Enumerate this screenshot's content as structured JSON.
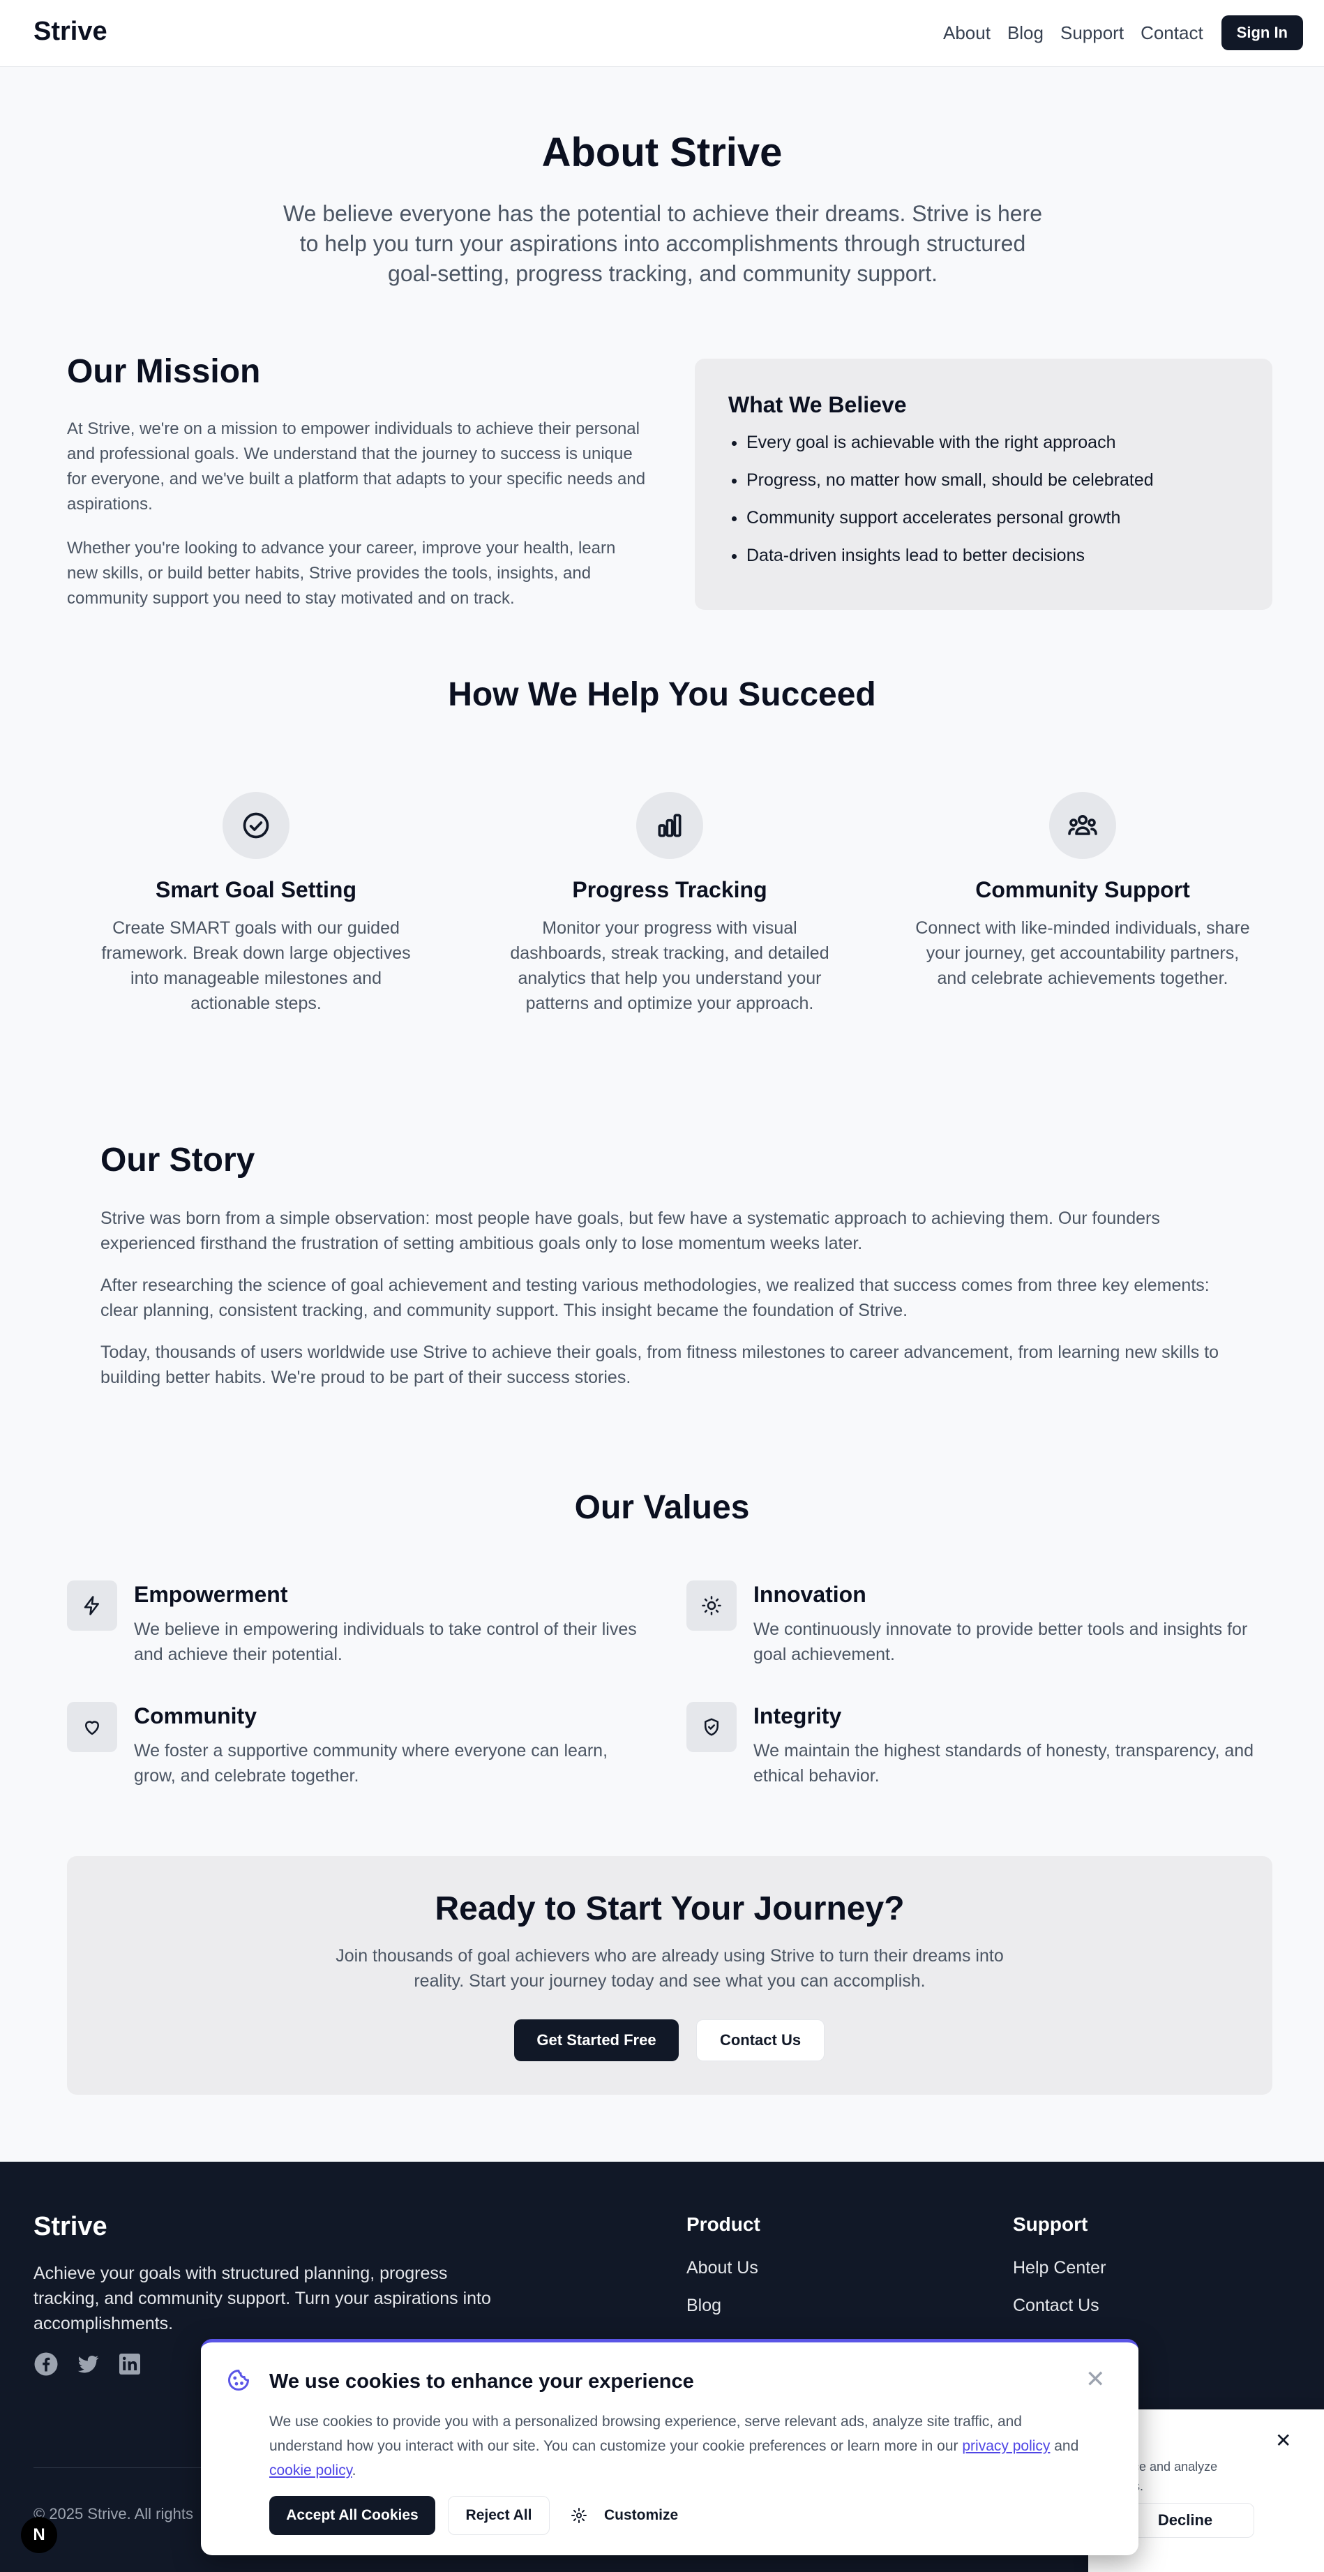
{
  "header": {
    "brand": "Strive",
    "nav": [
      "About",
      "Blog",
      "Support",
      "Contact"
    ],
    "sign_in": "Sign In"
  },
  "hero": {
    "title": "About Strive",
    "text": "We believe everyone has the potential to achieve their dreams. Strive is here to help you turn your aspirations into accomplishments through structured goal-setting, progress tracking, and community support."
  },
  "mission": {
    "title": "Our Mission",
    "p1": "At Strive, we're on a mission to empower individuals to achieve their personal and professional goals. We understand that the journey to success is unique for everyone, and we've built a platform that adapts to your specific needs and aspirations.",
    "p2": "Whether you're looking to advance your career, improve your health, learn new skills, or build better habits, Strive provides the tools, insights, and community support you need to stay motivated and on track."
  },
  "believe": {
    "title": "What We Believe",
    "items": [
      "Every goal is achievable with the right approach",
      "Progress, no matter how small, should be celebrated",
      "Community support accelerates personal growth",
      "Data-driven insights lead to better decisions"
    ]
  },
  "help": {
    "title": "How We Help You Succeed",
    "features": [
      {
        "icon": "check-circle-icon",
        "title": "Smart Goal Setting",
        "desc": "Create SMART goals with our guided framework. Break down large objectives into manageable milestones and actionable steps."
      },
      {
        "icon": "bar-chart-icon",
        "title": "Progress Tracking",
        "desc": "Monitor your progress with visual dashboards, streak tracking, and detailed analytics that help you understand your patterns and optimize your approach."
      },
      {
        "icon": "users-icon",
        "title": "Community Support",
        "desc": "Connect with like-minded individuals, share your journey, get accountability partners, and celebrate achievements together."
      }
    ]
  },
  "story": {
    "title": "Our Story",
    "p1": "Strive was born from a simple observation: most people have goals, but few have a systematic approach to achieving them. Our founders experienced firsthand the frustration of setting ambitious goals only to lose momentum weeks later.",
    "p2": "After researching the science of goal achievement and testing various methodologies, we realized that success comes from three key elements: clear planning, consistent tracking, and community support. This insight became the foundation of Strive.",
    "p3": "Today, thousands of users worldwide use Strive to achieve their goals, from fitness milestones to career advancement, from learning new skills to building better habits. We're proud to be part of their success stories."
  },
  "values": {
    "title": "Our Values",
    "items": [
      {
        "icon": "lightning-icon",
        "title": "Empowerment",
        "desc": "We believe in empowering individuals to take control of their lives and achieve their potential."
      },
      {
        "icon": "lightbulb-icon",
        "title": "Innovation",
        "desc": "We continuously innovate to provide better tools and insights for goal achievement."
      },
      {
        "icon": "heart-icon",
        "title": "Community",
        "desc": "We foster a supportive community where everyone can learn, grow, and celebrate together."
      },
      {
        "icon": "shield-check-icon",
        "title": "Integrity",
        "desc": "We maintain the highest standards of honesty, transparency, and ethical behavior."
      }
    ]
  },
  "cta": {
    "title": "Ready to Start Your Journey?",
    "text": "Join thousands of goal achievers who are already using Strive to turn their dreams into reality. Start your journey today and see what you can accomplish.",
    "primary": "Get Started Free",
    "secondary": "Contact Us"
  },
  "footer": {
    "brand": "Strive",
    "tagline": "Achieve your goals with structured planning, progress tracking, and community support. Turn your aspirations into accomplishments.",
    "social_icons": [
      "facebook-icon",
      "twitter-icon",
      "linkedin-icon"
    ],
    "product_title": "Product",
    "product_links": [
      "About Us",
      "Blog"
    ],
    "support_title": "Support",
    "support_links": [
      "Help Center",
      "Contact Us"
    ],
    "copyright": "© 2025 Strive. All rights"
  },
  "cookie_back": {
    "text": "ience and analyze\no us.",
    "decline": "Decline"
  },
  "cookie": {
    "title": "We use cookies to enhance your experience",
    "text_before": "We use cookies to provide you with a personalized browsing experience, serve relevant ads, analyze site traffic, and understand how you interact with our site. You can customize your cookie preferences or learn more in our ",
    "privacy_link": "privacy policy",
    "and": " and ",
    "cookie_link": "cookie policy",
    "period": ".",
    "accept": "Accept All Cookies",
    "reject": "Reject All",
    "customize": "Customize"
  },
  "badge": "N",
  "colors": {
    "dark": "#111827",
    "accent": "#5a55e6",
    "link": "#4f46e5",
    "footer_bg": "#111827"
  }
}
